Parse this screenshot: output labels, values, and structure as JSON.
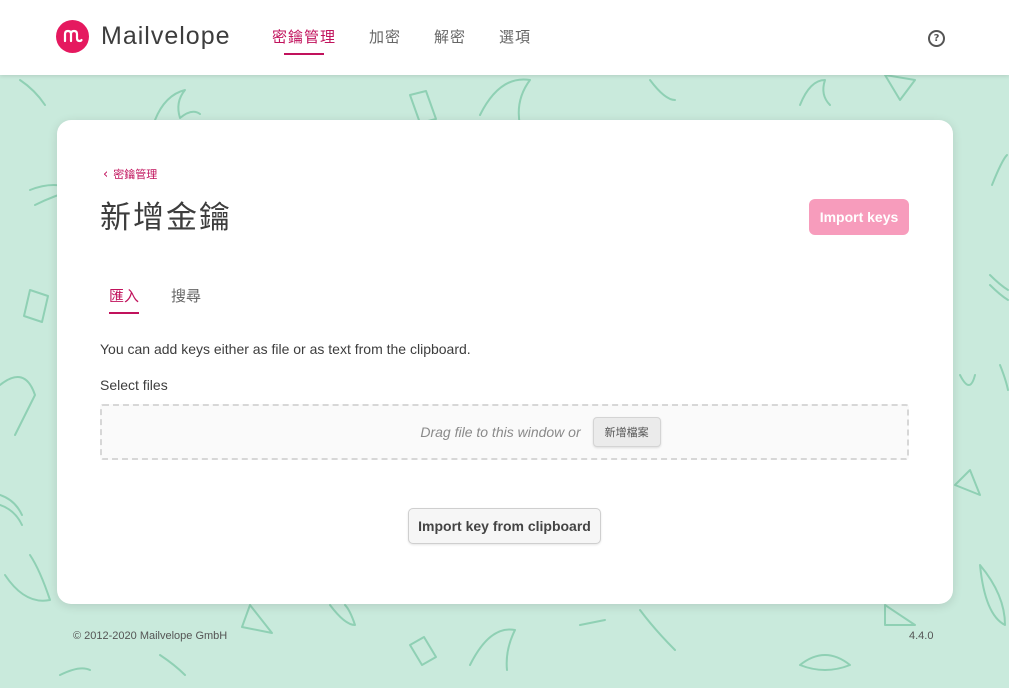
{
  "header": {
    "brand": "Mailvelope",
    "nav": [
      {
        "label": "密鑰管理",
        "active": true
      },
      {
        "label": "加密",
        "active": false
      },
      {
        "label": "解密",
        "active": false
      },
      {
        "label": "選項",
        "active": false
      }
    ],
    "help_label": "?"
  },
  "page": {
    "breadcrumb": "密鑰管理",
    "title": "新增金鑰",
    "import_keys_button": "Import keys",
    "tabs": [
      {
        "label": "匯入",
        "active": true
      },
      {
        "label": "搜尋",
        "active": false
      }
    ],
    "info_text": "You can add keys either as file or as text from the clipboard.",
    "select_files_label": "Select files",
    "dropzone_hint": "Drag file to this window or",
    "add_file_button": "新增檔案",
    "import_clipboard_button": "Import key from clipboard"
  },
  "footer": {
    "copyright": "© 2012-2020  Mailvelope GmbH",
    "version": "4.4.0"
  },
  "colors": {
    "accent": "#c1125c",
    "logo": "#e5195f",
    "import_button": "#f79cbc",
    "background": "#c9eadc",
    "pattern": "#8fd0b4"
  }
}
